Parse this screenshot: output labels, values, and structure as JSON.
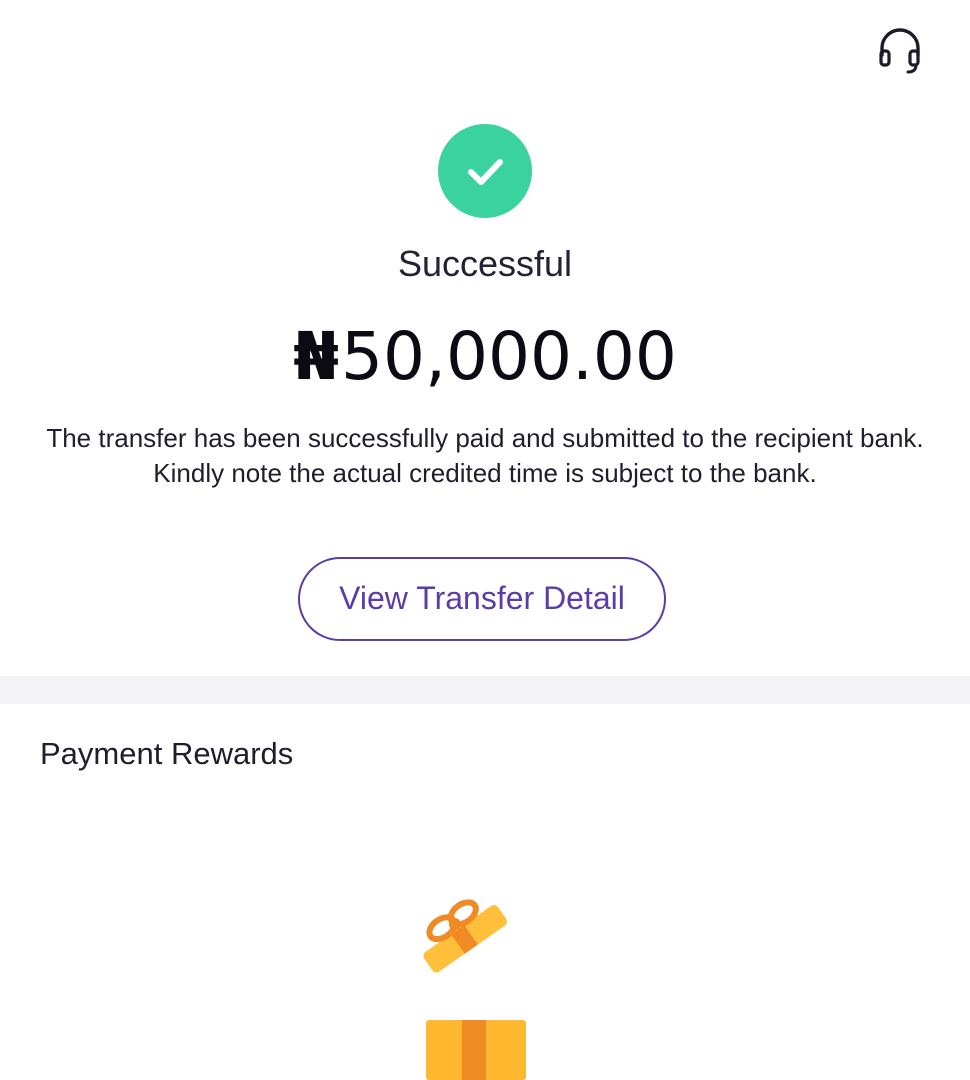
{
  "header": {
    "support_icon": "headset-icon"
  },
  "status": {
    "icon": "check-icon",
    "icon_color": "#3ad29f",
    "title": "Successful"
  },
  "amount": {
    "currency": "₦",
    "value": "50,000.00"
  },
  "message": "The transfer has been successfully paid and submitted to the recipient bank. Kindly note the actual credited time is subject to the bank.",
  "detail_button": {
    "label": "View Transfer Detail",
    "color": "#5b3da7"
  },
  "rewards": {
    "title": "Payment Rewards",
    "icon": "gift-box-icon",
    "icon_color": "#ffb830"
  }
}
